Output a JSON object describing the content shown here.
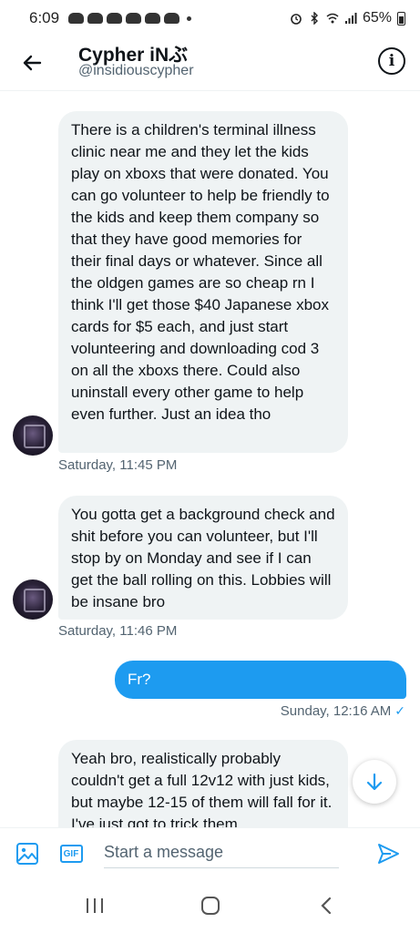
{
  "status_bar": {
    "time": "6:09",
    "battery": "65%"
  },
  "header": {
    "name": "Cypher iNぶ",
    "handle": "@insidiouscypher"
  },
  "messages": [
    {
      "direction": "in",
      "text": "There is a children's terminal illness clinic near me and they let the kids play on xboxs that were donated. You can go volunteer to help be friendly to the kids and keep them company so that they have good memories for their final days or whatever. Since all the oldgen games are so cheap rn I think I'll get those $40 Japanese xbox cards for $5 each, and just start volunteering and downloading cod 3 on all the xboxs there. Could also uninstall every other game to help even further. Just an idea tho",
      "timestamp": "Saturday, 11:45 PM"
    },
    {
      "direction": "in",
      "text": "You gotta get a background check and shit before you can volunteer, but I'll stop by on Monday and see if I can get the ball rolling on this. Lobbies will be insane bro",
      "timestamp": "Saturday, 11:46 PM"
    },
    {
      "direction": "out",
      "text": "Fr?",
      "timestamp": "Sunday, 12:16 AM"
    },
    {
      "direction": "in",
      "text": "Yeah bro, realistically probably couldn't get a full 12v12 with just kids, but maybe 12-15 of them will fall for it. I've just got to trick them"
    }
  ],
  "composer": {
    "placeholder": "Start a message",
    "image_icon": "image-icon",
    "gif_label": "GIF",
    "send_icon": "send-icon"
  },
  "colors": {
    "accent": "#1d9bf0",
    "incoming_bubble": "#eff3f4",
    "secondary_text": "#536471"
  }
}
